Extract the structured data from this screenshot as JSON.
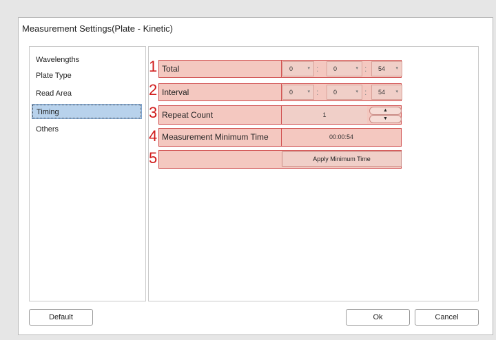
{
  "dialog": {
    "title": "Measurement Settings(Plate - Kinetic)"
  },
  "sidebar": {
    "items": [
      {
        "label": "Wavelengths"
      },
      {
        "label": "Plate Type"
      },
      {
        "label": "Read Area"
      },
      {
        "label": "Timing",
        "selected": true
      },
      {
        "label": "Others"
      }
    ]
  },
  "timing": {
    "total": {
      "number": "1",
      "label": "Total",
      "hours": "0",
      "minutes": "0",
      "seconds": "54"
    },
    "interval": {
      "number": "2",
      "label": "Interval",
      "hours": "0",
      "minutes": "0",
      "seconds": "54"
    },
    "repeat_count": {
      "number": "3",
      "label": "Repeat Count",
      "value": "1"
    },
    "min_time": {
      "number": "4",
      "label": "Measurement Minimum Time",
      "value": "00:00:54"
    },
    "apply": {
      "number": "5",
      "label": "Apply Minimum Time"
    },
    "separator": ":",
    "dropdown_arrow": "▾",
    "spin_up": "▲",
    "spin_down": "▼"
  },
  "footer": {
    "default_label": "Default",
    "ok_label": "Ok",
    "cancel_label": "Cancel"
  },
  "colors": {
    "highlight_fill": "#f4c8c0",
    "highlight_border": "#cf4a4a",
    "number_red": "#d01a1a",
    "selected_item": "#b8d2ec"
  }
}
